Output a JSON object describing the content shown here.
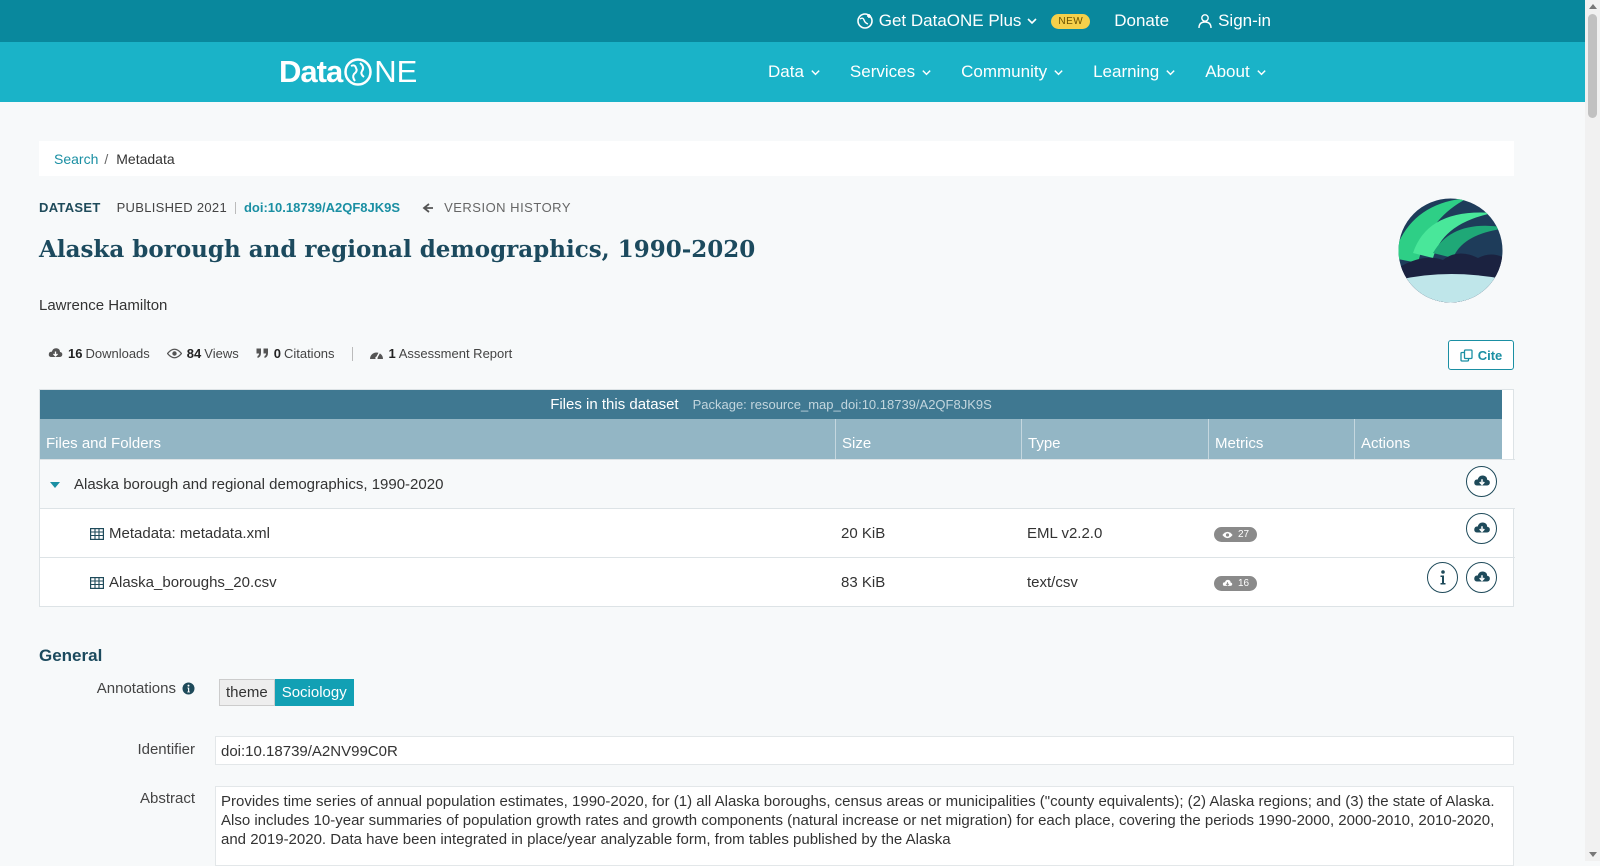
{
  "topbar": {
    "plus_label": "Get DataONE Plus",
    "new_badge": "NEW",
    "donate_label": "Donate",
    "signin_label": "Sign-in"
  },
  "navbar": {
    "logo_text_a": "Data",
    "logo_text_b": "NE",
    "items": [
      {
        "label": "Data"
      },
      {
        "label": "Services"
      },
      {
        "label": "Community"
      },
      {
        "label": "Learning"
      },
      {
        "label": "About"
      }
    ]
  },
  "breadcrumb": {
    "search_label": "Search",
    "separator": "/",
    "current": "Metadata"
  },
  "dataset": {
    "type_label": "DATASET",
    "published_label": "PUBLISHED 2021",
    "doi": "doi:10.18739/A2QF8JK9S",
    "version_history_label": "VERSION HISTORY",
    "title": "Alaska borough and regional demographics, 1990-2020",
    "author": "Lawrence Hamilton"
  },
  "stats": {
    "downloads_count": "16",
    "downloads_label": "Downloads",
    "views_count": "84",
    "views_label": "Views",
    "citations_count": "0",
    "citations_label": "Citations",
    "assessment_count": "1",
    "assessment_label": "Assessment Report",
    "cite_label": "Cite"
  },
  "files_table": {
    "header_title": "Files in this dataset",
    "package_label": "Package: resource_map_doi:10.18739/A2QF8JK9S",
    "columns": [
      "Files and Folders",
      "Size",
      "Type",
      "Metrics",
      "Actions"
    ],
    "folder_name": "Alaska borough and regional demographics, 1990-2020",
    "rows": [
      {
        "name": "Metadata: metadata.xml",
        "size": "20 KiB",
        "type": "EML v2.2.0",
        "metric": "27",
        "metric_icon": "eye-icon"
      },
      {
        "name": "Alaska_boroughs_20.csv",
        "size": "83 KiB",
        "type": "text/csv",
        "metric": "16",
        "metric_icon": "cloud-download-icon"
      }
    ]
  },
  "general": {
    "section_title": "General",
    "annotations_label": "Annotations",
    "annotation_key": "theme",
    "annotation_value": "Sociology",
    "identifier_label": "Identifier",
    "identifier_value": "doi:10.18739/A2NV99C0R",
    "abstract_label": "Abstract",
    "abstract_text": "Provides time series of annual population estimates, 1990-2020, for (1) all Alaska boroughs, census areas or municipalities (\"county equivalents); (2) Alaska regions; and (3) the state of Alaska. Also includes 10-year summaries of population growth rates and growth components (natural increase or net migration) for each place, covering the periods 1990-2000, 2000-2010, 2010-2020, and 2019-2020. Data have been integrated in place/year analyzable form, from tables published by the Alaska"
  },
  "colors": {
    "topbar": "#09889d",
    "navbar": "#1ab3c8",
    "accent": "#1a8fa3",
    "heading": "#1c4a5e",
    "table_header": "#3f7891",
    "table_colhead": "#93b6c5"
  }
}
